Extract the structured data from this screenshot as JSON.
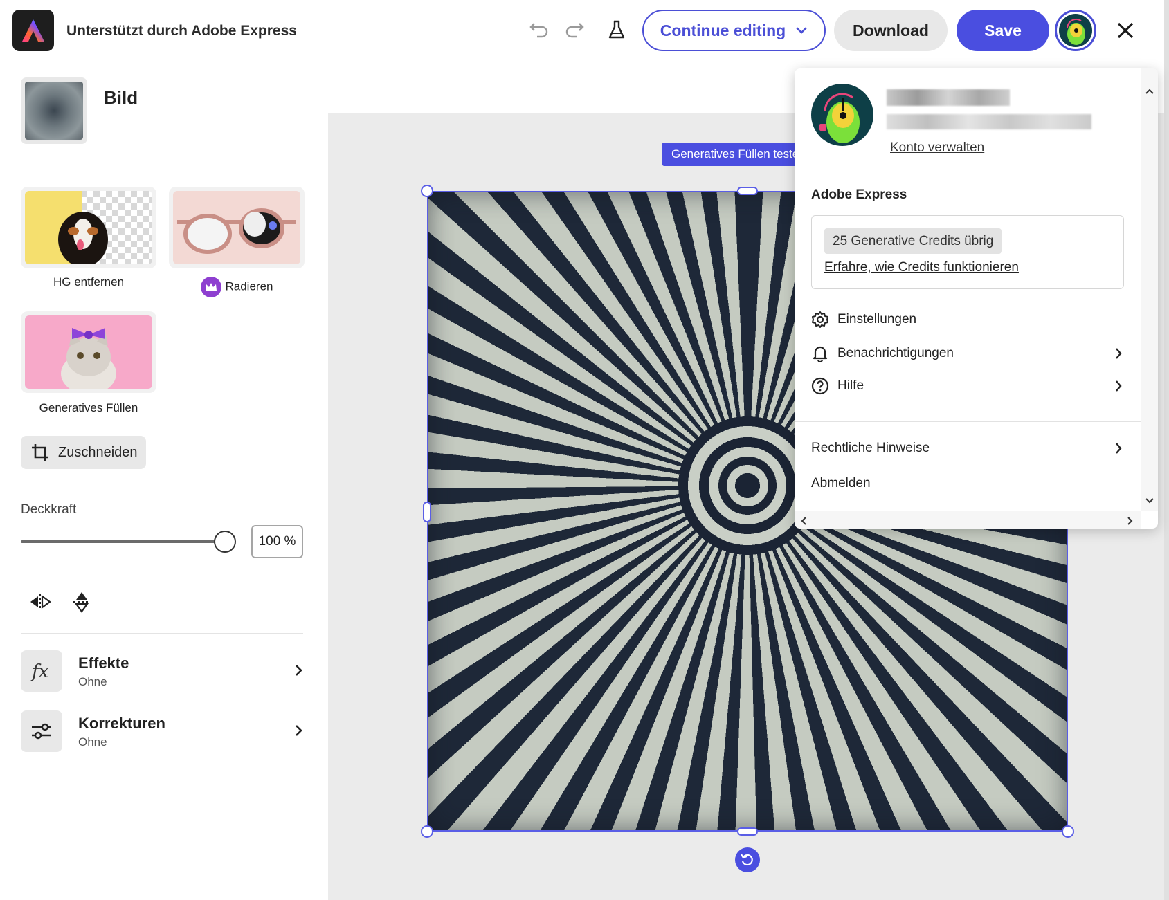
{
  "header": {
    "app_title": "Unterstützt durch Adobe Express",
    "continue_label": "Continue editing",
    "download_label": "Download",
    "save_label": "Save"
  },
  "left_panel": {
    "section_title": "Bild",
    "tools": [
      {
        "label": "HG entfernen"
      },
      {
        "label": "Radieren",
        "premium": true
      },
      {
        "label": "Generatives Füllen"
      }
    ],
    "crop_label": "Zuschneiden",
    "opacity_label": "Deckkraft",
    "opacity_value": "100 %",
    "opacity_fraction": 1.0,
    "rows": [
      {
        "title": "Effekte",
        "subtitle": "Ohne"
      },
      {
        "title": "Korrekturen",
        "subtitle": "Ohne"
      }
    ]
  },
  "canvas": {
    "gen_fill_pill": "Generatives Füllen testen"
  },
  "profile_menu": {
    "manage_account": "Konto verwalten",
    "section_title": "Adobe Express",
    "credits_badge": "25 Generative Credits übrig",
    "credits_link": "Erfahre, wie Credits funktionieren",
    "items": [
      {
        "label": "Einstellungen",
        "icon": "gear-icon"
      },
      {
        "label": "Benachrichtigungen",
        "icon": "bell-icon"
      },
      {
        "label": "Hilfe",
        "icon": "help-icon"
      }
    ],
    "legal": "Rechtliche Hinweise",
    "logout": "Abmelden"
  },
  "colors": {
    "accent": "#4a4ee0",
    "crown": "#8e3fd0"
  }
}
